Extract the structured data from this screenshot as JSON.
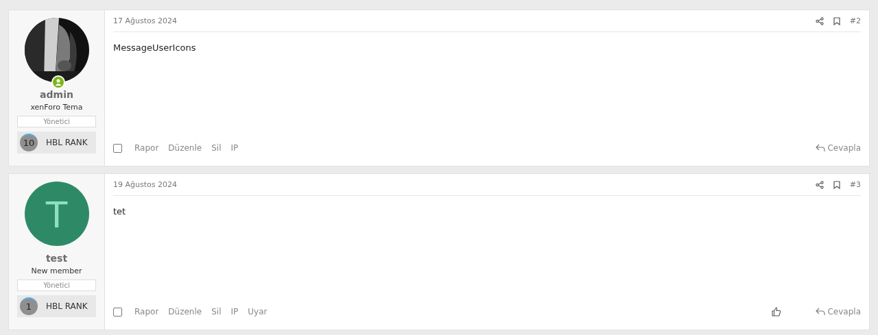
{
  "posts": [
    {
      "date": "17 Ağustos 2024",
      "number": "#2",
      "body": "MessageUserIcons",
      "checked": false,
      "online": true,
      "user": {
        "name": "admin",
        "title": "xenForo Tema",
        "banner": "Yönetici",
        "rank": "10",
        "rank_label": "HBL RANK"
      },
      "actions": [
        "Rapor",
        "Düzenle",
        "Sil",
        "IP"
      ],
      "reply": "Cevapla"
    },
    {
      "date": "19 Ağustos 2024",
      "number": "#3",
      "body": "tet",
      "checked": false,
      "liked": false,
      "online": false,
      "user": {
        "avatar": {
          "kind": "letter",
          "letter": "T",
          "color": "#2e8a66"
        },
        "name": "test",
        "title": "New member",
        "banner": "Yönetici",
        "rank": "1",
        "rank_label": "HBL RANK"
      },
      "actions": [
        "Rapor",
        "Düzenle",
        "Sil",
        "IP",
        "Uyar"
      ],
      "reply": "Cevapla"
    }
  ]
}
